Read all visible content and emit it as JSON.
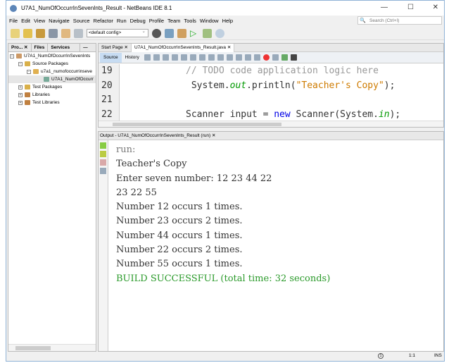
{
  "window": {
    "title": "U7A1_NumOfOccurrInSevenInts_Result - NetBeans IDE 8.1",
    "minimize": "—",
    "maximize": "☐",
    "close": "✕"
  },
  "menu": [
    "File",
    "Edit",
    "View",
    "Navigate",
    "Source",
    "Refactor",
    "Run",
    "Debug",
    "Profile",
    "Team",
    "Tools",
    "Window",
    "Help"
  ],
  "search": {
    "placeholder": "Search (Ctrl+I)"
  },
  "toolbar": {
    "config": "<default config>"
  },
  "left_panel": {
    "tabs": [
      "Pro... ✕",
      "Files",
      "Services",
      "—"
    ],
    "tree": [
      "U7A1_NumOfOccurrInSevenInts",
      "Source Packages",
      "u7a1_numofoccurrinseve",
      "U7A1_NumOfOccurr",
      "Test Packages",
      "Libraries",
      "Test Libraries"
    ]
  },
  "editor": {
    "tabs": [
      "Start Page ✕",
      "U7A1_NumOfOccurrInSevenInts_Result.java ✕"
    ],
    "source": "Source",
    "history": "History",
    "line_numbers": [
      "19",
      "20",
      "21",
      "22"
    ],
    "lines": {
      "l19": "// TODO code application logic here",
      "l20a": " System.",
      "l20b": "out",
      "l20c": ".println(",
      "l20d": "\"Teacher's Copy\"",
      "l20e": ");",
      "l22a": "Scanner input = ",
      "l22b": "new",
      "l22c": " Scanner(System.",
      "l22d": "in",
      "l22e": ");"
    }
  },
  "output": {
    "title": "Output - U7A1_NumOfOccurrInSevenInts_Result (run) ✕",
    "lines": [
      "run:",
      "Teacher's Copy",
      "Enter seven number: 12 23 44 22",
      "23 22 55",
      "Number 12 occurs 1 times.",
      "Number 23 occurs 2 times.",
      "Number 44 occurs 1 times.",
      "Number 22 occurs 2 times.",
      "Number 55 occurs 1 times."
    ],
    "build": "BUILD SUCCESSFUL (total time: 32 seconds)"
  },
  "status": {
    "notifications": "1",
    "position": "1:1",
    "mode": "INS"
  }
}
